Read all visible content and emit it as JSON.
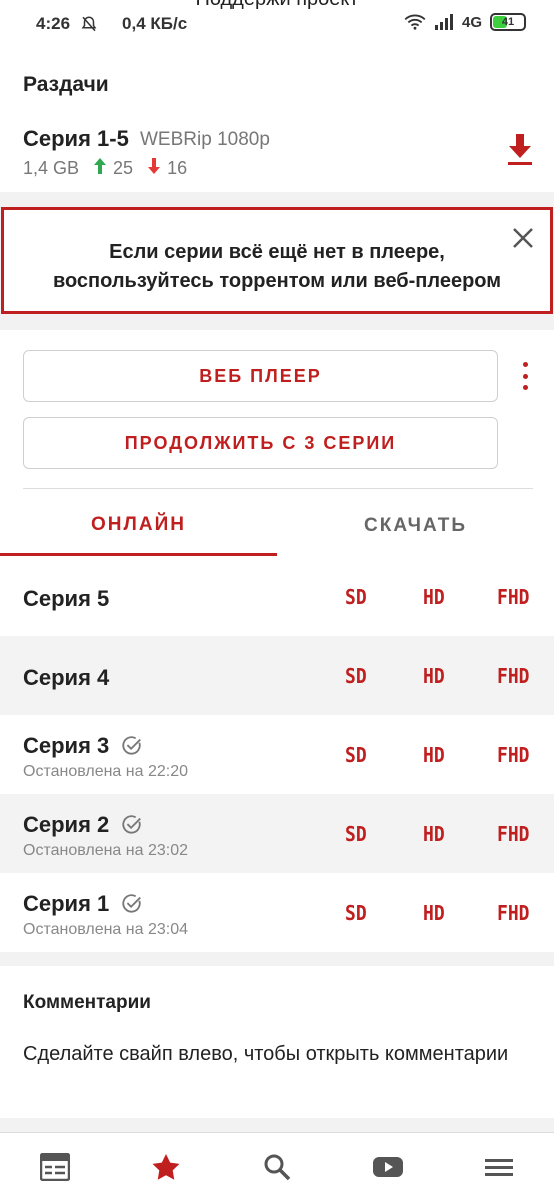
{
  "status_bar": {
    "top_cut_text": "Поддержи проект ",
    "time": "4:26",
    "speed": "0,4 КБ/с",
    "network": "4G",
    "battery": "41"
  },
  "releases": {
    "title": "Раздачи",
    "item": {
      "name": "Серия 1-5",
      "quality": "WEBRip 1080p",
      "size": "1,4 GB",
      "seeds": "25",
      "leeches": "16"
    }
  },
  "notice": {
    "line1": "Если серии всё ещё нет в плеере,",
    "line2": "воспользуйтесь торрентом или веб-плеером"
  },
  "actions": {
    "web_player": "ВЕБ ПЛЕЕР",
    "continue": "ПРОДОЛЖИТЬ С 3 СЕРИИ"
  },
  "tabs": {
    "online": "ОНЛАЙН",
    "download": "СКАЧАТЬ"
  },
  "quality_labels": {
    "sd": "SD",
    "hd": "HD",
    "fhd": "FHD"
  },
  "episodes": [
    {
      "title": "Серия 5",
      "watched": false,
      "sub": ""
    },
    {
      "title": "Серия 4",
      "watched": false,
      "sub": ""
    },
    {
      "title": "Серия 3",
      "watched": true,
      "sub": "Остановлена на 22:20"
    },
    {
      "title": "Серия 2",
      "watched": true,
      "sub": "Остановлена на 23:02"
    },
    {
      "title": "Серия 1",
      "watched": true,
      "sub": "Остановлена на 23:04"
    }
  ],
  "comments": {
    "title": "Комментарии",
    "hint": "Сделайте свайп влево, чтобы открыть комментарии"
  },
  "bottom_nav": [
    {
      "icon": "feed-icon",
      "active": false
    },
    {
      "icon": "star-icon",
      "active": true
    },
    {
      "icon": "search-icon",
      "active": false
    },
    {
      "icon": "youtube-icon",
      "active": false
    },
    {
      "icon": "menu-icon",
      "active": false
    }
  ],
  "colors": {
    "accent": "#c01f1f",
    "seed": "#2fa84f",
    "leech": "#e53935"
  }
}
